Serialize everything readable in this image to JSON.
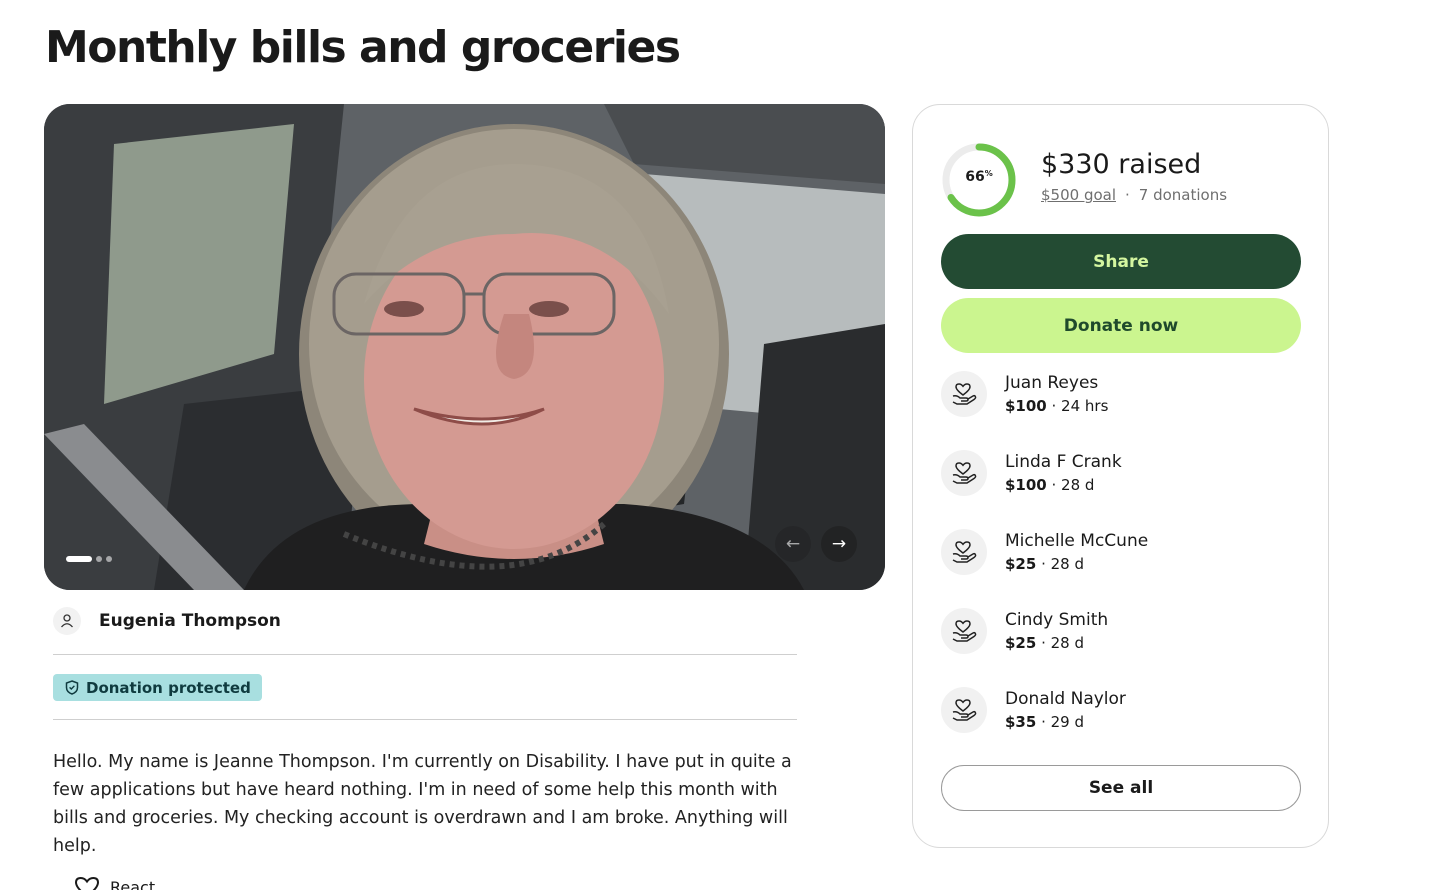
{
  "campaign": {
    "title": "Monthly bills and groceries",
    "organizer": "Eugenia Thompson",
    "badge": "Donation protected",
    "story": "Hello. My name is Jeanne Thompson. I'm currently on Disability. I have put in quite a few applications but have heard nothing. I'm in need of some help this month with bills and groceries. My checking account is overdrawn and I am broke. Anything will help.",
    "react_label": "React"
  },
  "carousel": {
    "slide_count": 3,
    "active_slide": 1,
    "prev_icon": "arrow-left-icon",
    "next_icon": "arrow-right-icon"
  },
  "summary": {
    "progress_percent": 66,
    "progress_label": "66",
    "percent_sign": "%",
    "raised": "$330 raised",
    "goal": "$500 goal",
    "separator": "·",
    "donations_count": "7 donations"
  },
  "actions": {
    "share": "Share",
    "donate": "Donate now",
    "see_all": "See all"
  },
  "donations": [
    {
      "name": "Juan Reyes",
      "amount": "$100",
      "time": " · 24 hrs",
      "icon": "heart-hand-icon"
    },
    {
      "name": "Linda F Crank",
      "amount": "$100",
      "time": " · 28 d",
      "icon": "heart-hand-icon"
    },
    {
      "name": "Michelle McCune",
      "amount": "$25",
      "time": " · 28 d",
      "icon": "heart-hand-icon"
    },
    {
      "name": "Cindy Smith",
      "amount": "$25",
      "time": " · 28 d",
      "icon": "heart-hand-icon"
    },
    {
      "name": "Donald Naylor",
      "amount": "$35",
      "time": " · 29 d",
      "icon": "heart-hand-icon"
    }
  ],
  "colors": {
    "share_bg": "#234b33",
    "share_text": "#d4f6a0",
    "donate_bg": "#cbf58f",
    "progress": "#6bc24a",
    "badge_bg": "#a8dfe0"
  }
}
